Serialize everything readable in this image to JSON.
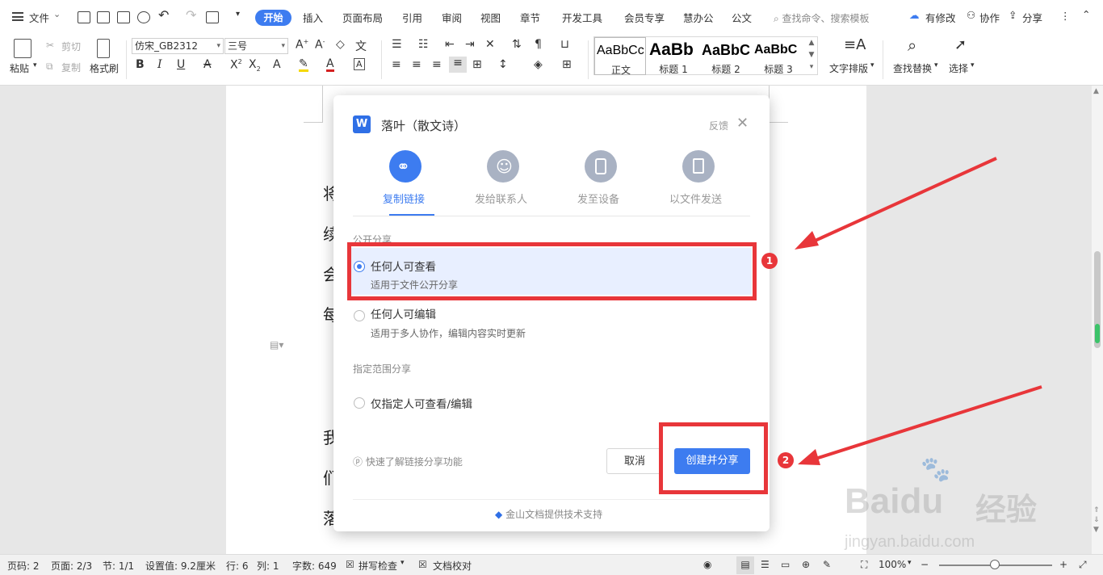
{
  "menubar": {
    "file_label": "文件",
    "tabs": [
      "开始",
      "插入",
      "页面布局",
      "引用",
      "审阅",
      "视图",
      "章节",
      "开发工具",
      "会员专享",
      "慧办公",
      "公文"
    ],
    "search_placeholder": "查找命令、搜索模板",
    "right": {
      "modify": "有修改",
      "collab": "协作",
      "share": "分享"
    }
  },
  "ribbon": {
    "paste": "粘贴",
    "cut": "剪切",
    "copy": "复制",
    "format_painter": "格式刷",
    "font_name": "仿宋_GB2312",
    "font_size": "三号",
    "styles": [
      {
        "sample": "AaBbCc",
        "name": "正文"
      },
      {
        "sample": "AaBb",
        "name": "标题 1"
      },
      {
        "sample": "AaBbC",
        "name": "标题 2"
      },
      {
        "sample": "AaBbC",
        "name": "标题 3"
      }
    ],
    "text_layout": "文字排版",
    "find_replace": "查找替换",
    "select": "选择"
  },
  "document": {
    "visible_chars": [
      "将",
      "续",
      "会",
      "每",
      "我",
      "们",
      "落"
    ]
  },
  "dialog": {
    "title": "落叶（散文诗）",
    "feedback": "反馈",
    "tabs": [
      "复制链接",
      "发给联系人",
      "发至设备",
      "以文件发送"
    ],
    "public_section": "公开分享",
    "option1_title": "任何人可查看",
    "option1_sub": "适用于文件公开分享",
    "option2_title": "任何人可编辑",
    "option2_sub": "适用于多人协作，编辑内容实时更新",
    "restricted_section": "指定范围分享",
    "option3_title": "仅指定人可查看/编辑",
    "help_link": "快速了解链接分享功能",
    "cancel": "取消",
    "create_share": "创建并分享",
    "powered_by": "金山文档提供技术支持"
  },
  "annotations": {
    "badge1": "1",
    "badge2": "2"
  },
  "statusbar": {
    "page_no": "页码: 2",
    "pages": "页面: 2/3",
    "section": "节: 1/1",
    "setting": "设置值: 9.2厘米",
    "row": "行: 6",
    "col": "列: 1",
    "word_count": "字数: 649",
    "spell_check": "拼写检查",
    "doc_check": "文档校对",
    "zoom": "100%"
  },
  "watermark": {
    "brand": "Baidu",
    "brand_cn": "经验",
    "url": "jingyan.baidu.com"
  },
  "colors": {
    "accent": "#3d7cf0",
    "annotation_red": "#e8363a"
  }
}
